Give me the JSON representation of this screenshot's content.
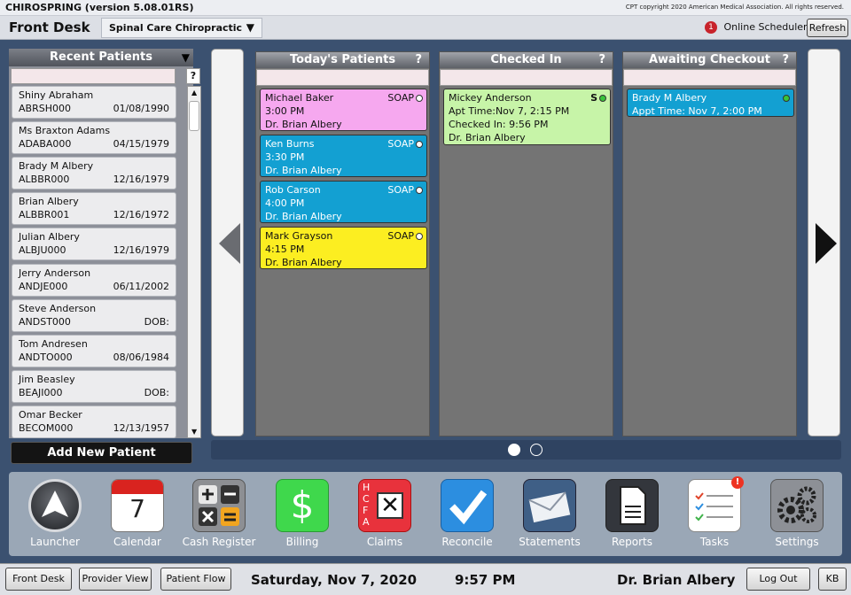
{
  "title_bar": {
    "app": "CHIROSPRING (version 5.08.01RS)",
    "copyright": "CPT copyright 2020 American Medical Association. All rights reserved."
  },
  "toolbar": {
    "section": "Front Desk",
    "clinic": "Spinal Care Chiropractic",
    "scheduler_badge": "1",
    "scheduler_label": "Online Scheduler",
    "refresh": "Refresh"
  },
  "recent": {
    "title": "Recent Patients",
    "help": "?",
    "patients": [
      {
        "name": "Shiny Abraham",
        "id": "ABRSH000",
        "dob": "01/08/1990"
      },
      {
        "name": "Ms Braxton Adams",
        "id": "ADABA000",
        "dob": "04/15/1979"
      },
      {
        "name": "Brady M Albery",
        "id": "ALBBR000",
        "dob": "12/16/1979"
      },
      {
        "name": "Brian Albery",
        "id": "ALBBR001",
        "dob": "12/16/1972"
      },
      {
        "name": "Julian Albery",
        "id": "ALBJU000",
        "dob": "12/16/1979"
      },
      {
        "name": "Jerry Anderson",
        "id": "ANDJE000",
        "dob": "06/11/2002"
      },
      {
        "name": "Steve Anderson",
        "id": "ANDST000",
        "dob": "DOB:"
      },
      {
        "name": "Tom Andresen",
        "id": "ANDTO000",
        "dob": "08/06/1984"
      },
      {
        "name": "Jim Beasley",
        "id": "BEAJI000",
        "dob": "DOB:"
      },
      {
        "name": "Omar Becker",
        "id": "BECOM000",
        "dob": "12/13/1957"
      }
    ],
    "add_new": "Add New Patient"
  },
  "columns": {
    "today": {
      "title": "Today's Patients",
      "help": "?",
      "cards": [
        {
          "name": "Michael Baker",
          "time": "3:00 PM",
          "doctor": "Dr. Brian Albery",
          "tag": "SOAP",
          "color": "#f6a8ef",
          "dark": false
        },
        {
          "name": "Ken Burns",
          "time": "3:30 PM",
          "doctor": "Dr. Brian Albery",
          "tag": "SOAP",
          "color": "#13a0d2",
          "dark": true
        },
        {
          "name": "Rob Carson",
          "time": "4:00 PM",
          "doctor": "Dr. Brian Albery",
          "tag": "SOAP",
          "color": "#13a0d2",
          "dark": true
        },
        {
          "name": "Mark Grayson",
          "time": "4:15 PM",
          "doctor": "Dr. Brian Albery",
          "tag": "SOAP",
          "color": "#fcee21",
          "dark": false
        }
      ]
    },
    "checked_in": {
      "title": "Checked In",
      "help": "?",
      "card": {
        "name": "Mickey Anderson",
        "appt": "Apt Time:Nov 7, 2:15 PM",
        "checked": "Checked In: 9:56 PM",
        "doctor": "Dr. Brian Albery",
        "tag": "S",
        "color": "#c7f4a8"
      }
    },
    "awaiting": {
      "title": "Awaiting Checkout",
      "help": "?",
      "card": {
        "name": "Brady M Albery",
        "appt": "Appt Time: Nov 7, 2:00 PM",
        "color": "#13a0d2"
      }
    }
  },
  "dock": [
    {
      "label": "Launcher",
      "icon": "launcher-icon"
    },
    {
      "label": "Calendar",
      "icon": "calendar-icon",
      "number": "7"
    },
    {
      "label": "Cash Register",
      "icon": "cash-register-icon"
    },
    {
      "label": "Billing",
      "icon": "billing-icon",
      "glyph": "$"
    },
    {
      "label": "Claims",
      "icon": "claims-icon",
      "letters": "HCFA"
    },
    {
      "label": "Reconcile",
      "icon": "reconcile-icon"
    },
    {
      "label": "Statements",
      "icon": "statements-icon"
    },
    {
      "label": "Reports",
      "icon": "reports-icon"
    },
    {
      "label": "Tasks",
      "icon": "tasks-icon",
      "badge": "!"
    },
    {
      "label": "Settings",
      "icon": "settings-icon"
    }
  ],
  "bottom": {
    "front_desk": "Front Desk",
    "provider_view": "Provider View",
    "patient_flow": "Patient Flow",
    "date": "Saturday, Nov 7, 2020",
    "time": "9:57 PM",
    "provider": "Dr. Brian Albery",
    "logout": "Log Out",
    "initials": "KB"
  }
}
